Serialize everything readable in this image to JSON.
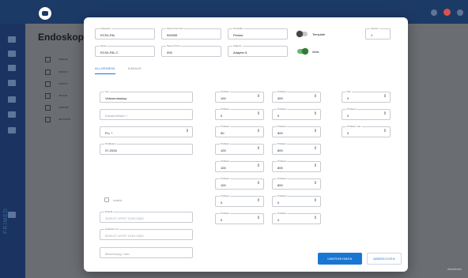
{
  "background": {
    "page_title": "Endoskop",
    "rows": [
      "Aufbereit",
      "INF8472",
      "INF8473",
      "INF 8A8",
      "ECB1706",
      "INF PHP78"
    ],
    "brand": "FRIMED",
    "bottom_right": "Abmelden"
  },
  "modal": {
    "top_fields": {
      "kategorie": {
        "label": "Kategorie",
        "value": "ECS4-F8L"
      },
      "serial": {
        "label": "Serien Nummer",
        "value": "500055"
      },
      "hersteller": {
        "label": "Hersteller",
        "value": "Pentax"
      },
      "name": {
        "label": "Name",
        "value": "ECS4-F8L C"
      },
      "serien_kurz": {
        "label": "Serien Kürze",
        "value": "005"
      },
      "adapter": {
        "label": "Adapter",
        "value": "Adapter 8"
      },
      "version": {
        "label": "Version",
        "value": "1"
      }
    },
    "toggles": {
      "template": {
        "label": "Template",
        "state": "off"
      },
      "aktiv": {
        "label": "Aktiv",
        "state": "on"
      }
    },
    "tabs": [
      {
        "label": "ALLGEMEIN",
        "active": true
      },
      {
        "label": "KANALE",
        "active": false
      }
    ],
    "left_fields": {
      "typ": {
        "label": "Typ",
        "value": "Videoendoskop"
      },
      "kanal": {
        "label": "",
        "value": "Kanalauflöden *"
      },
      "pu": {
        "label": "",
        "value": "P.u. *"
      },
      "datum": {
        "label": "Prüfdatum",
        "value": "07-2026"
      },
      "check_label": "Inaktiv",
      "erstell": {
        "label": "Erstellt",
        "value": "2023-07-10T07 13:02.0423"
      },
      "geaendert": {
        "label": "Geändert am",
        "value": "2023-07-10T07 13:02.0423"
      },
      "bemerkung": {
        "label": "",
        "value": "Bemerkung / Info"
      }
    },
    "col1": [
      {
        "label": "Prüfwert",
        "value": "100"
      },
      {
        "label": "Prüfwert",
        "value": "0"
      },
      {
        "label": "Prüfwert",
        "value": "90"
      },
      {
        "label": "Prüfwert",
        "value": "100"
      },
      {
        "label": "Prüfwert",
        "value": "100"
      },
      {
        "label": "Prüfwert",
        "value": "100"
      },
      {
        "label": "Prüfwert",
        "value": "0"
      },
      {
        "label": "Prüfwert",
        "value": "0"
      }
    ],
    "col2": [
      {
        "label": "Prüfwert",
        "value": "300"
      },
      {
        "label": "Prüfwert",
        "value": "0"
      },
      {
        "label": "Prüfwert",
        "value": "800"
      },
      {
        "label": "Prüfwert",
        "value": "800"
      },
      {
        "label": "Prüfwert",
        "value": "800"
      },
      {
        "label": "Prüfwert",
        "value": "800"
      },
      {
        "label": "Prüfwert",
        "value": "0"
      },
      {
        "label": "Prüfwert",
        "value": "0"
      }
    ],
    "col3": [
      {
        "label": "Min",
        "value": "0"
      },
      {
        "label": "Prüfwert",
        "value": "0"
      },
      {
        "label": "Prüfwert max",
        "value": "0"
      }
    ],
    "buttons": {
      "save": "ÜBERNEHMEN",
      "cancel": "ABBRECHEN"
    },
    "stepper_glyph": "⇕",
    "dropdown_glyph": "⇕"
  },
  "colors": {
    "primary": "#1976d2",
    "toggle_on": "#66bb6a",
    "topbar": "#1c3a66"
  }
}
